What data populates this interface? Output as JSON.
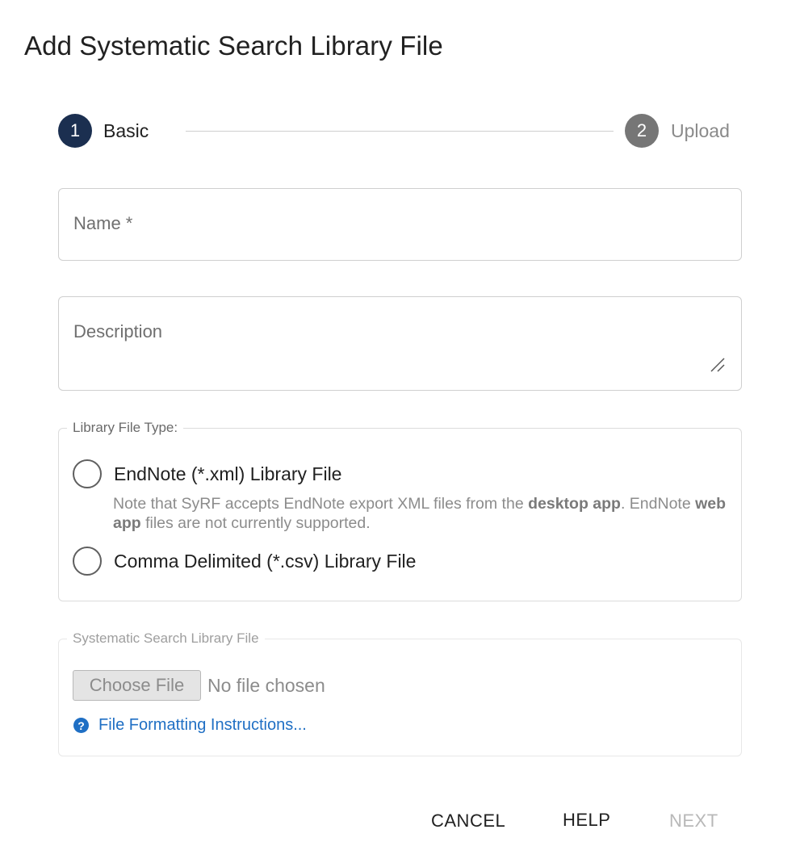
{
  "dialog": {
    "title": "Add Systematic Search Library File"
  },
  "stepper": {
    "steps": [
      {
        "number": "1",
        "label": "Basic",
        "active": true
      },
      {
        "number": "2",
        "label": "Upload",
        "active": false
      }
    ]
  },
  "form": {
    "name": {
      "placeholder": "Name *",
      "value": ""
    },
    "description": {
      "placeholder": "Description",
      "value": ""
    },
    "library_type": {
      "legend": "Library File Type:",
      "options": [
        {
          "label": "EndNote (*.xml) Library File",
          "selected": false
        },
        {
          "label": "Comma Delimited (*.csv) Library File",
          "selected": false
        }
      ],
      "note": {
        "part1": "Note that SyRF accepts EndNote export XML files from the ",
        "bold1": "desktop app",
        "part2": ". EndNote ",
        "bold2": "web app",
        "part3": " files are not currently supported."
      }
    },
    "library_file": {
      "legend": "Systematic Search Library File",
      "choose_label": "Choose File",
      "status": "No file chosen",
      "help_link": "File Formatting Instructions...",
      "help_icon": "question-circle-icon"
    }
  },
  "actions": {
    "cancel": "CANCEL",
    "help": "HELP",
    "next": "NEXT"
  },
  "colors": {
    "step_active": "#1b2f50",
    "step_inactive": "#767676",
    "link": "#1f6fc4"
  }
}
